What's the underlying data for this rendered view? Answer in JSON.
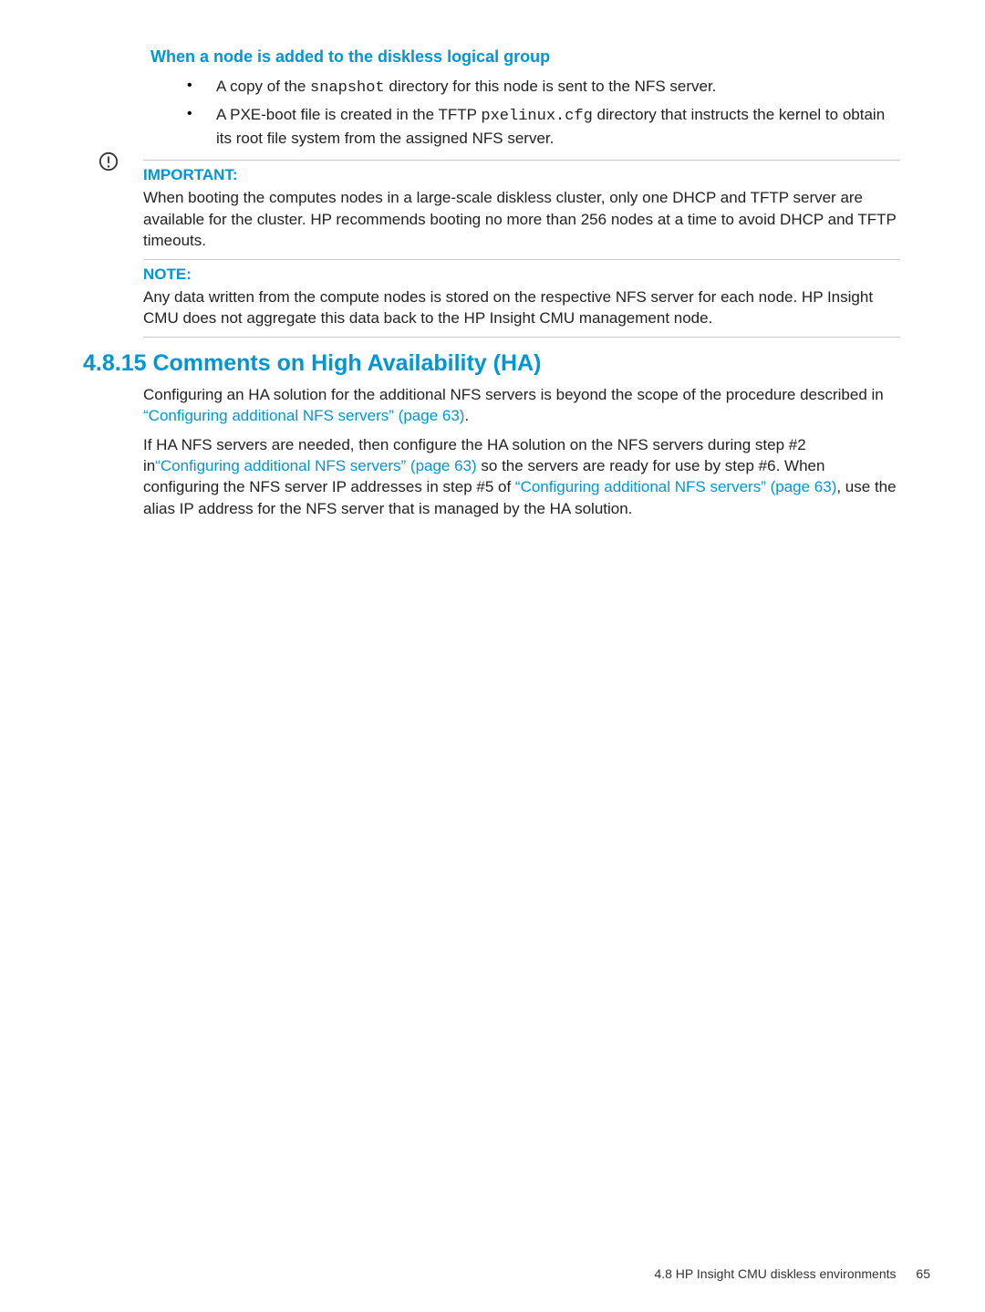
{
  "sub_heading": "When a node is added to the diskless logical group",
  "bullets": [
    {
      "pre": "A copy of the ",
      "code": "snapshot",
      "post": " directory for this node is sent to the NFS server."
    },
    {
      "pre": "A PXE-boot file is created in the TFTP ",
      "code": "pxelinux.cfg",
      "post": " directory that instructs the kernel to obtain its root file system from the assigned NFS server."
    }
  ],
  "important_label": "IMPORTANT:",
  "important_body": "When booting the computes nodes in a large-scale diskless cluster, only one DHCP and TFTP server are available for the cluster. HP recommends booting no more than 256 nodes at a time to avoid DHCP and TFTP timeouts.",
  "note_label": "NOTE:",
  "note_body": "Any data written from the compute nodes is stored on the respective NFS server for each node. HP Insight CMU does not aggregate this data back to the HP Insight CMU management node.",
  "h2": "4.8.15 Comments on High Availability (HA)",
  "p1_a": "Configuring an HA solution for the additional NFS servers is beyond the scope of the procedure described in ",
  "p1_link": "“Configuring additional NFS servers” (page 63)",
  "p1_b": ".",
  "p2_a": "If HA NFS servers are needed, then configure the HA solution on the NFS servers during step #2 in",
  "p2_link1": "“Configuring additional NFS servers” (page 63)",
  "p2_b": " so the servers are ready for use by step #6. When configuring the NFS server IP addresses in step #5 of ",
  "p2_link2": "“Configuring additional NFS servers” (page 63)",
  "p2_c": ", use the alias IP address for the NFS server that is managed by the HA solution.",
  "footer_text": "4.8 HP Insight CMU diskless environments",
  "footer_page": "65"
}
